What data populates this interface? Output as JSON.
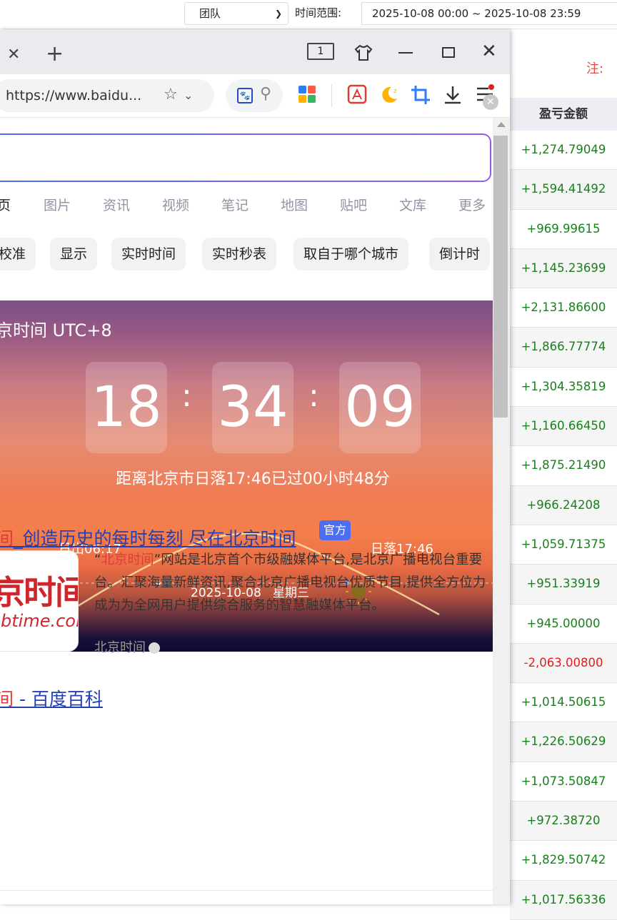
{
  "filter_bar": {
    "team_select": "团队",
    "range_label": "时间范围:",
    "range_value": "2025-10-08 00:00 ~ 2025-10-08 23:59"
  },
  "note": "注:",
  "pl_table": {
    "header": "盈亏金额",
    "rows": [
      "+1,274.79049",
      "+1,594.41492",
      "+969.99615",
      "+1,145.23699",
      "+2,131.86600",
      "+1,866.77774",
      "+1,304.35819",
      "+1,160.66450",
      "+1,875.21490",
      "+966.24208",
      "+1,059.71375",
      "+951.33919",
      "+945.00000",
      "-2,063.00800",
      "+1,014.50615",
      "+1,226.50629",
      "+1,073.50847",
      "+972.38720",
      "+1,829.50742",
      "+1,017.56336"
    ],
    "positive_color": "#18801c",
    "negative_color": "#e02020"
  },
  "browser": {
    "tab_count": "1",
    "url": "https://www.baidu..."
  },
  "baidu": {
    "nav": [
      "页",
      "图片",
      "资讯",
      "视频",
      "笔记",
      "地图",
      "贴吧",
      "文库",
      "更多"
    ],
    "chips": [
      "校准",
      "显示",
      "实时时间",
      "实时秒表",
      "取自于哪个城市",
      "倒计时"
    ],
    "card": {
      "title": "京时间 UTC+8",
      "hours": "18",
      "minutes": "34",
      "seconds": "09",
      "since_sunset": "距离北京市日落17:46已过00小时48分",
      "sunrise": "日出06:17",
      "sunset": "日落17:46",
      "date": "2025-10-08",
      "weekday": "星期三"
    },
    "result1": {
      "title_prefix": "间",
      "title": "_创造历史的每时每刻 尽在北京时间",
      "badge": "官方",
      "logo_cn": "京时间",
      "logo_en": "btime.com",
      "desc_quote_open": "“",
      "desc_highlight": "北京时间",
      "desc_rest": "”网站是北京首个市级融媒体平台,是北京广播电视台重要台。汇聚海量新鲜资讯,聚合北京广播电视台优质节目,提供全方位力成为为全网用户提供综合服务的智慧融媒体平台。",
      "source": "北京时间"
    },
    "result2": {
      "title_prefix": "间",
      "title": " - 百度百科"
    }
  }
}
